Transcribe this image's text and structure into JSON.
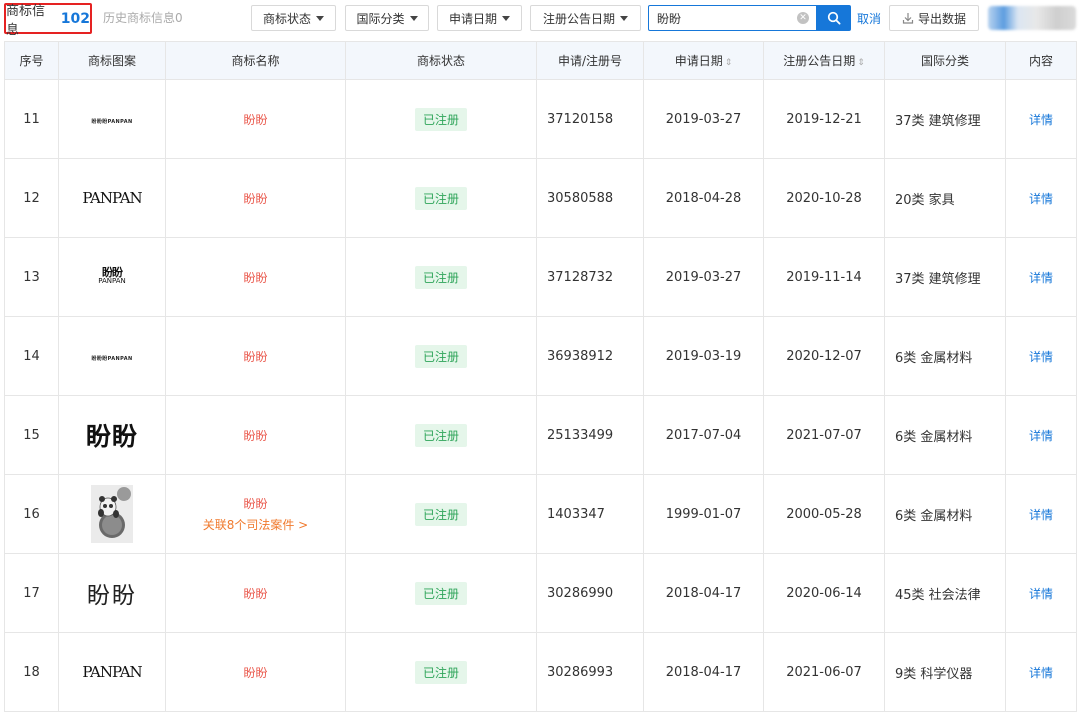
{
  "tabs": {
    "current_label": "商标信息",
    "current_count": "102",
    "history_label": "历史商标信息0"
  },
  "filters": [
    {
      "label": "商标状态"
    },
    {
      "label": "国际分类"
    },
    {
      "label": "申请日期"
    },
    {
      "label": "注册公告日期"
    }
  ],
  "search": {
    "value": "盼盼",
    "cancel_label": "取消"
  },
  "export_label": "导出数据",
  "table": {
    "headers": {
      "seq": "序号",
      "logo": "商标图案",
      "name": "商标名称",
      "status": "商标状态",
      "regno": "申请/注册号",
      "apply_date": "申请日期",
      "pub_date": "注册公告日期",
      "class": "国际分类",
      "content": "内容"
    },
    "sort_glyph": "⇕",
    "rows": [
      {
        "seq": "11",
        "logo_text": "盼盼盼PANPAN",
        "name": "盼盼",
        "case_link": "",
        "status": "已注册",
        "regno": "37120158",
        "apply_date": "2019-03-27",
        "pub_date": "2019-12-21",
        "class": "37类 建筑修理",
        "detail": "详情"
      },
      {
        "seq": "12",
        "logo_text": "PANPAN",
        "name": "盼盼",
        "case_link": "",
        "status": "已注册",
        "regno": "30580588",
        "apply_date": "2018-04-28",
        "pub_date": "2020-10-28",
        "class": "20类 家具",
        "detail": "详情"
      },
      {
        "seq": "13",
        "logo_text": "盼盼",
        "logo_sub": "PANPAN",
        "name": "盼盼",
        "case_link": "",
        "status": "已注册",
        "regno": "37128732",
        "apply_date": "2019-03-27",
        "pub_date": "2019-11-14",
        "class": "37类 建筑修理",
        "detail": "详情"
      },
      {
        "seq": "14",
        "logo_text": "盼盼盼PANPAN",
        "name": "盼盼",
        "case_link": "",
        "status": "已注册",
        "regno": "36938912",
        "apply_date": "2019-03-19",
        "pub_date": "2020-12-07",
        "class": "6类 金属材料",
        "detail": "详情"
      },
      {
        "seq": "15",
        "logo_text": "盼盼",
        "name": "盼盼",
        "case_link": "",
        "status": "已注册",
        "regno": "25133499",
        "apply_date": "2017-07-04",
        "pub_date": "2021-07-07",
        "class": "6类 金属材料",
        "detail": "详情"
      },
      {
        "seq": "16",
        "logo_text": "",
        "name": "盼盼",
        "case_link": "关联8个司法案件 >",
        "status": "已注册",
        "regno": "1403347",
        "apply_date": "1999-01-07",
        "pub_date": "2000-05-28",
        "class": "6类 金属材料",
        "detail": "详情"
      },
      {
        "seq": "17",
        "logo_text": "盼盼",
        "name": "盼盼",
        "case_link": "",
        "status": "已注册",
        "regno": "30286990",
        "apply_date": "2018-04-17",
        "pub_date": "2020-06-14",
        "class": "45类 社会法律",
        "detail": "详情"
      },
      {
        "seq": "18",
        "logo_text": "PANPAN",
        "name": "盼盼",
        "case_link": "",
        "status": "已注册",
        "regno": "30286993",
        "apply_date": "2018-04-17",
        "pub_date": "2021-06-07",
        "class": "9类 科学仪器",
        "detail": "详情"
      }
    ]
  },
  "colors": {
    "accent": "#1677d9",
    "highlight_border": "#e52222",
    "name_text": "#ea5a4e",
    "case_link": "#f07a2e",
    "badge_bg": "#e5f6ea",
    "badge_text": "#2fa55a",
    "header_bg": "#f3f7fc"
  },
  "icons": {
    "search": "search-icon",
    "clear": "clear-icon",
    "export": "download-icon",
    "dropdown": "caret-down-icon"
  }
}
